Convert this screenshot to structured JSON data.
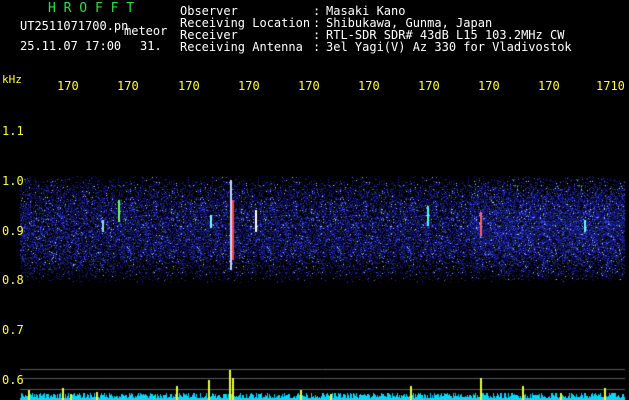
{
  "header": {
    "brand": "H R O F F T",
    "filename": "UT2511071700.pn",
    "mode": "meteor",
    "datetime": "25.11.07 17:00",
    "frame": "31.",
    "fields": [
      {
        "label": "Observer",
        "sep": ":",
        "value": "Masaki Kano"
      },
      {
        "label": "Receiving Location",
        "sep": ":",
        "value": "Shibukawa, Gunma, Japan"
      },
      {
        "label": "Receiver",
        "sep": ":",
        "value": "RTL-SDR SDR# 43dB L15 103.2MHz CW"
      },
      {
        "label": "Receiving Antenna",
        "sep": ":",
        "value": "3el Yagi(V) Az 330 for Vladivostok"
      }
    ]
  },
  "axes": {
    "y_unit": "kHz",
    "y_ticks": [
      "1.1",
      "1.0",
      "0.9",
      "0.8",
      "0.7",
      "0.6"
    ],
    "x_ticks": [
      "170",
      "170",
      "170",
      "170",
      "170",
      "170",
      "170",
      "170",
      "170",
      "1710"
    ]
  },
  "colors": {
    "brand": "#2ee040",
    "axis_text": "#ffff40",
    "header_text": "#ffffff",
    "spectrum_low": "#10106a",
    "spectrum_high": "#8ab4ff",
    "baseline": "#00d8ff"
  }
}
